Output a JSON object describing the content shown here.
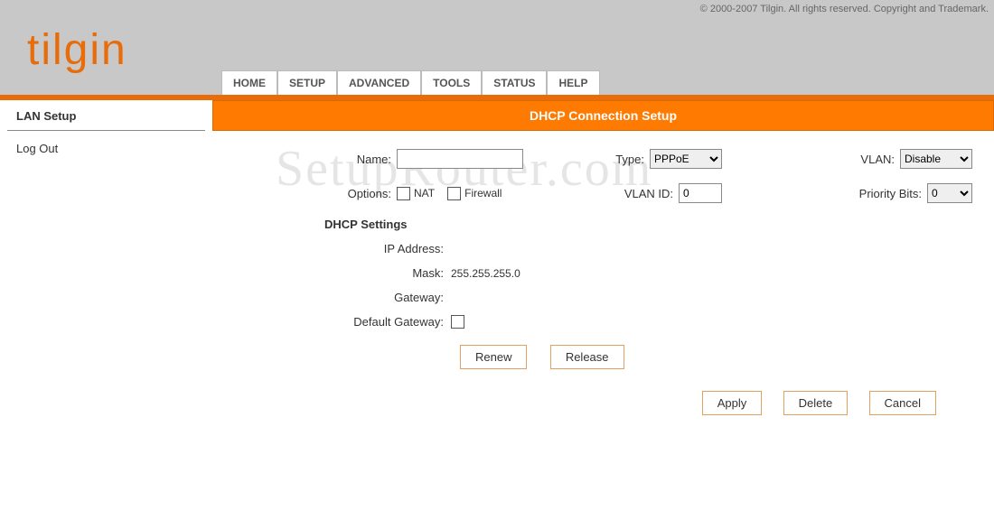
{
  "copyright": "© 2000-2007 Tilgin. All rights reserved. Copyright and Trademark.",
  "logo_text": "tilgin",
  "nav": {
    "home": "HOME",
    "setup": "SETUP",
    "advanced": "ADVANCED",
    "tools": "TOOLS",
    "status": "STATUS",
    "help": "HELP"
  },
  "sidebar": {
    "section": "LAN Setup",
    "logout": "Log Out"
  },
  "panel": {
    "title": "DHCP Connection Setup",
    "labels": {
      "name": "Name:",
      "type": "Type:",
      "vlan": "VLAN:",
      "options": "Options:",
      "nat": "NAT",
      "firewall": "Firewall",
      "vlan_id": "VLAN ID:",
      "priority_bits": "Priority Bits:"
    },
    "values": {
      "name": "",
      "type": "PPPoE",
      "vlan": "Disable",
      "vlan_id": "0",
      "priority_bits": "0"
    },
    "dhcp": {
      "heading": "DHCP Settings",
      "ip_label": "IP Address:",
      "ip_value": "",
      "mask_label": "Mask:",
      "mask_value": "255.255.255.0",
      "gateway_label": "Gateway:",
      "gateway_value": "",
      "default_gw_label": "Default Gateway:"
    },
    "buttons": {
      "renew": "Renew",
      "release": "Release",
      "apply": "Apply",
      "delete": "Delete",
      "cancel": "Cancel"
    }
  },
  "watermark": "SetupRouter.com"
}
